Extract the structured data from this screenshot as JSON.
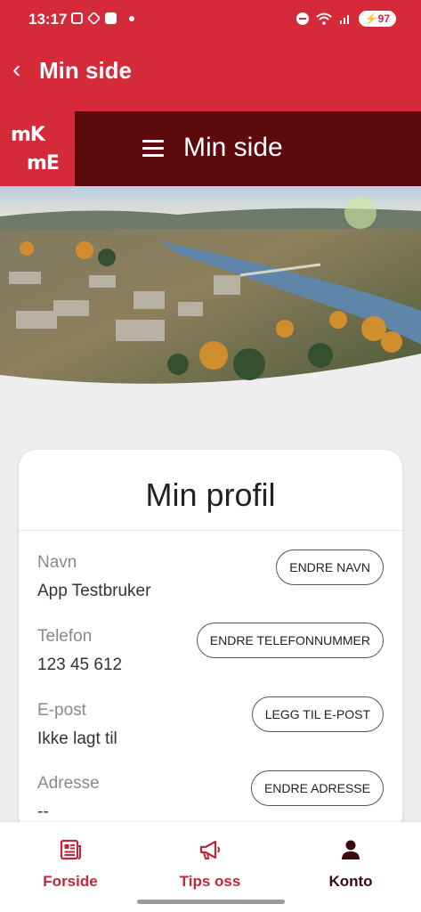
{
  "status_bar": {
    "time": "13:17",
    "battery": "97"
  },
  "app_bar": {
    "back_glyph": "‹",
    "title": "Min side"
  },
  "banner": {
    "logo_top": "mK",
    "logo_bottom": "mE",
    "title": "Min side"
  },
  "profile": {
    "heading": "Min profil",
    "fields": [
      {
        "label": "Navn",
        "value": "App Testbruker",
        "button": "ENDRE NAVN"
      },
      {
        "label": "Telefon",
        "value": "123 45 612",
        "button": "ENDRE TELEFONNUMMER"
      },
      {
        "label": "E-post",
        "value": "Ikke lagt til",
        "button": "LEGG TIL E-POST"
      },
      {
        "label": "Adresse",
        "value": "--",
        "button": "ENDRE ADRESSE"
      }
    ]
  },
  "tabs": [
    {
      "label": "Forside",
      "icon": "newspaper-icon"
    },
    {
      "label": "Tips oss",
      "icon": "megaphone-icon"
    },
    {
      "label": "Konto",
      "icon": "person-icon"
    }
  ],
  "colors": {
    "brand_red": "#d42a3a",
    "banner_dark": "#5d0a0c",
    "tab_red": "#c1263b",
    "tab_active": "#3a0a0e"
  }
}
